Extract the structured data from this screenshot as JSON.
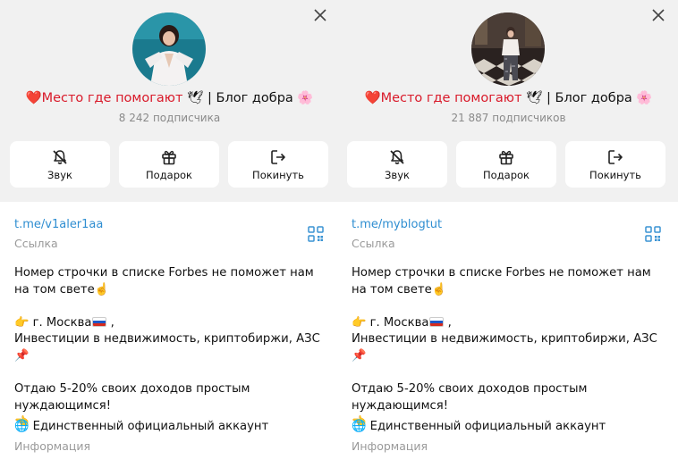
{
  "panels": [
    {
      "title_left": "❤️Место где помогают",
      "title_dove": "🕊",
      "title_right": " | Блог добра",
      "title_flower": "🌸",
      "subscribers": "8 242 подписчика",
      "buttons": {
        "sound": "Звук",
        "gift": "Подарок",
        "leave": "Покинуть"
      },
      "link": "t.me/v1aler1aa",
      "link_label": "Ссылка",
      "desc_line1": "Номер строчки в списке Forbes не поможет нам на том свете☝️",
      "desc_city_prefix": "👉 г. Москва",
      "desc_city_suffix": " ,",
      "desc_line3": "Инвестиции в недвижимость, криптобиржи, АЗС 📌",
      "desc_line4": "Отдаю 5-20% своих доходов простым нуждающимся!",
      "desc_line5": "👈",
      "official": "🌐 Единственный официальный аккаунт",
      "info_label": "Информация"
    },
    {
      "title_left": "❤️Место где помогают",
      "title_dove": "🕊",
      "title_right": " | Блог добра",
      "title_flower": "🌸",
      "subscribers": "21 887 подписчиков",
      "buttons": {
        "sound": "Звук",
        "gift": "Подарок",
        "leave": "Покинуть"
      },
      "link": "t.me/myblogtut",
      "link_label": "Ссылка",
      "desc_line1": "Номер строчки в списке Forbes не поможет нам на том свете☝️",
      "desc_city_prefix": "👉 г. Москва",
      "desc_city_suffix": " ,",
      "desc_line3": "Инвестиции в недвижимость, криптобиржи, АЗС 📌",
      "desc_line4": "Отдаю 5-20% своих доходов простым нуждающимся!",
      "desc_line5": "👈",
      "official": "🌐 Единственный официальный аккаунт",
      "info_label": "Информация"
    }
  ],
  "icons": [
    "close-icon",
    "bell-off-icon",
    "gift-icon",
    "logout-icon",
    "qr-code-icon"
  ],
  "colors": {
    "accent_link": "#2f8ed1",
    "header_bg": "#f1f1f1",
    "muted": "#8a8a8a"
  }
}
